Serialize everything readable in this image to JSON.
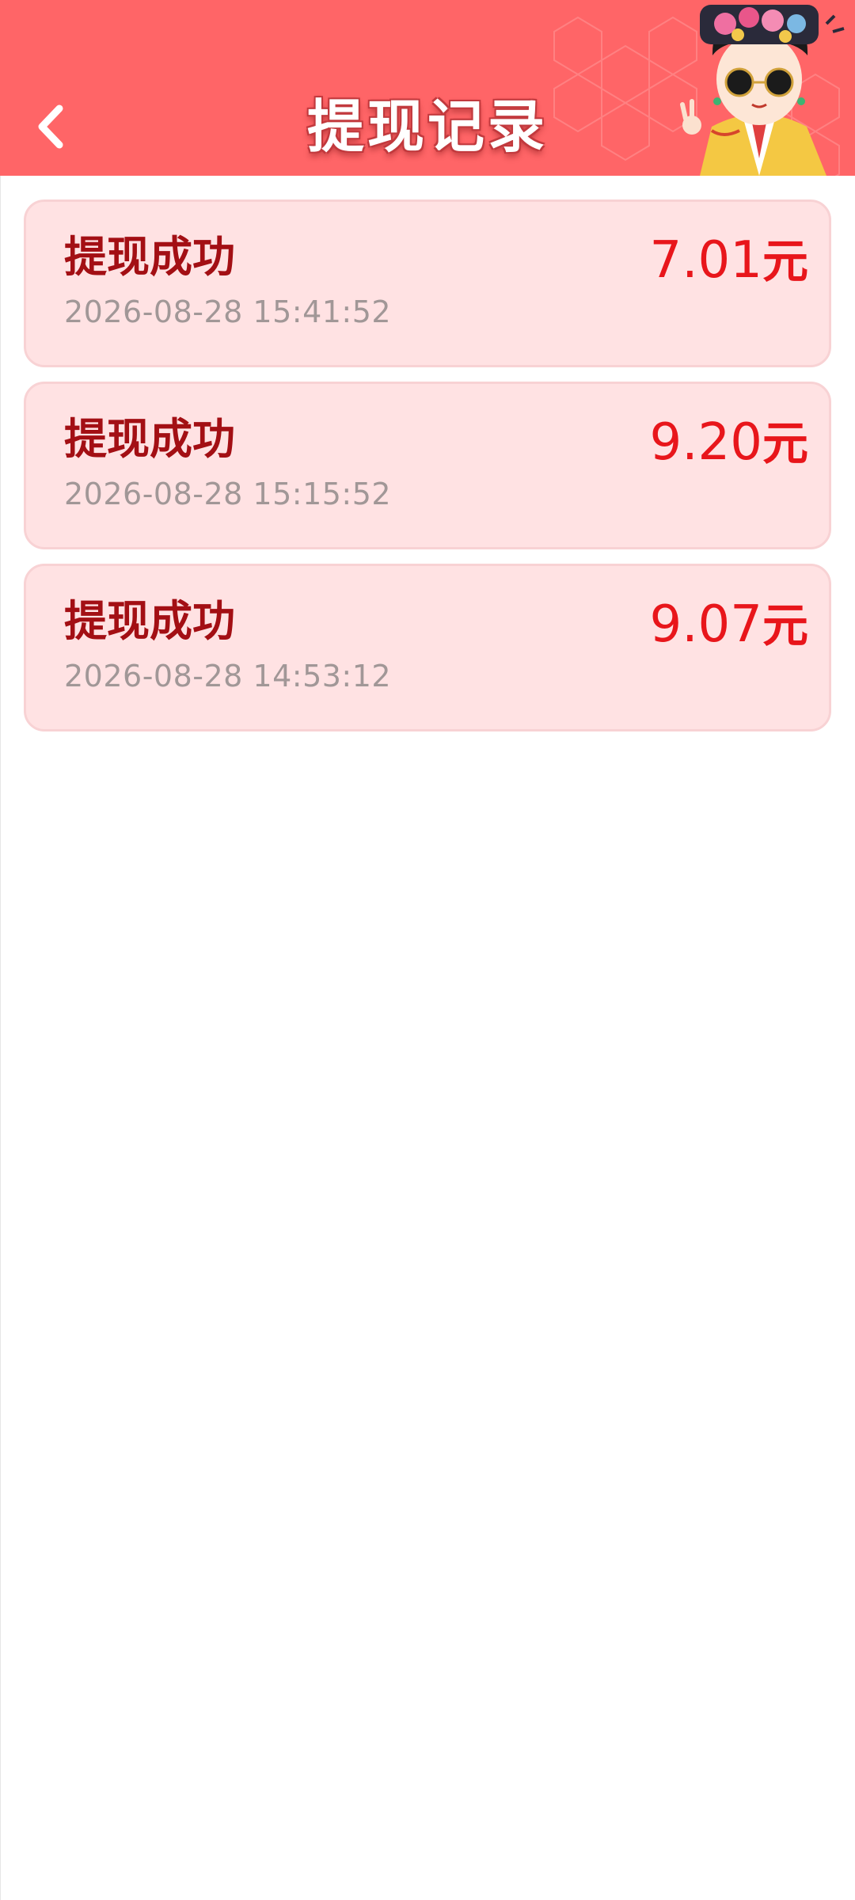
{
  "header": {
    "title": "提现记录",
    "back_icon": "chevron-left-icon",
    "background_color": "#ff6567",
    "mascot": "cartoon-qing-princess-with-sunglasses"
  },
  "records": [
    {
      "status": "提现成功",
      "time": "2026-08-28 15:41:52",
      "amount": "7.01",
      "unit": "元"
    },
    {
      "status": "提现成功",
      "time": "2026-08-28 15:15:52",
      "amount": "9.20",
      "unit": "元"
    },
    {
      "status": "提现成功",
      "time": "2026-08-28 14:53:12",
      "amount": "9.07",
      "unit": "元"
    }
  ],
  "colors": {
    "card_bg": "#ffe2e3",
    "status_text": "#a30f14",
    "amount_text": "#e8161b",
    "time_text": "#a19797"
  }
}
